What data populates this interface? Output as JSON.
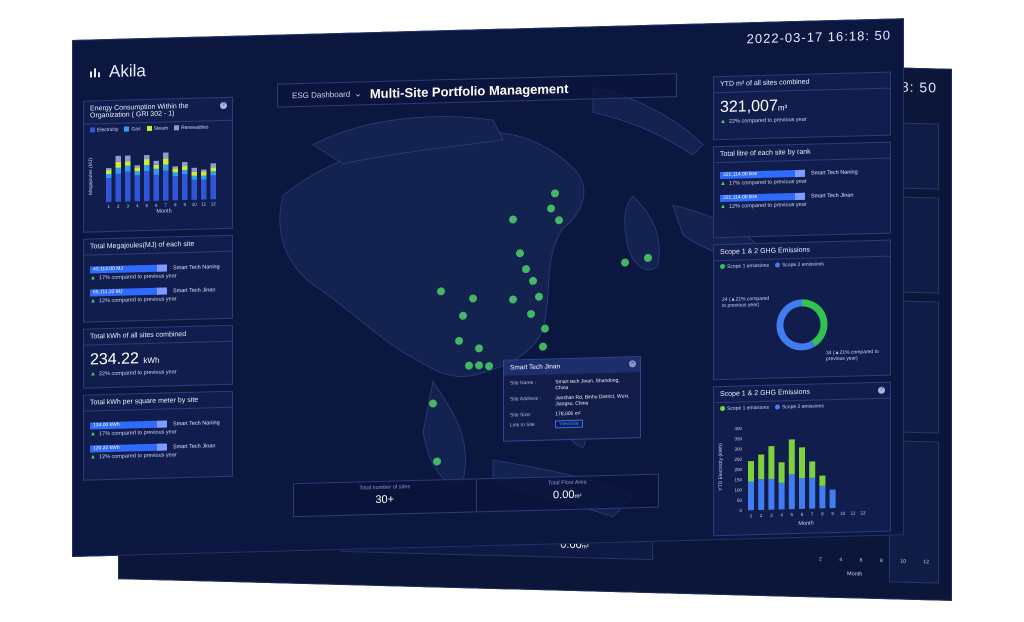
{
  "back_screen": {
    "clock": "16:18: 50",
    "total_sites": "30+",
    "total_area": "0.00",
    "area_unit": "m²",
    "month_label": "Month",
    "tick_values": [
      "2",
      "4",
      "6",
      "8",
      "10",
      "12"
    ]
  },
  "header": {
    "brand": "Akila",
    "datetime": "2022-03-17  16:18: 50",
    "dropdown_label": "ESG Dashboard",
    "title": "Multi-Site Portfolio Management"
  },
  "energy_panel": {
    "title": "Energy Consumption Within the Organization ( GRI 302 - 1)",
    "legend": [
      "Electricity",
      "Gas",
      "Steam",
      "Renewables"
    ],
    "ylabel": "Megajoules (MJ)",
    "xlabel": "Month",
    "chart_data": {
      "type": "bar",
      "categories": [
        "1",
        "2",
        "3",
        "4",
        "5",
        "6",
        "7",
        "8",
        "9",
        "10",
        "11",
        "12"
      ],
      "series": [
        {
          "name": "Electricity",
          "values": [
            12,
            14,
            15,
            13,
            15,
            13,
            15,
            12,
            13,
            10,
            10,
            12
          ]
        },
        {
          "name": "Gas",
          "values": [
            2,
            3,
            3,
            2,
            3,
            3,
            3,
            2,
            2,
            2,
            2,
            2
          ]
        },
        {
          "name": "Steam",
          "values": [
            2,
            3,
            2,
            2,
            3,
            2,
            3,
            2,
            2,
            2,
            2,
            2
          ]
        },
        {
          "name": "Renewables",
          "values": [
            1,
            3,
            3,
            1,
            2,
            2,
            3,
            1,
            2,
            2,
            1,
            2
          ]
        }
      ]
    },
    "colors": {
      "Electricity": "#2f55d8",
      "Gas": "#2f9ef0",
      "Steam": "#d0e838",
      "Renewables": "#8f9ccb"
    }
  },
  "mj_panel": {
    "title": "Total Megajoules(MJ) of each site",
    "rows": [
      {
        "value": "43,114.00 MJ",
        "site": "Smart Tech Naning",
        "compare": "17% compared to previous year"
      },
      {
        "value": "65,111.22 MJ",
        "site": "Smart Tech Jinan",
        "compare": "12% compared to previous year"
      }
    ]
  },
  "kwh_panel": {
    "title": "Total kWh of all sites combined",
    "value": "234.22",
    "unit": "kWh",
    "compare": "22% compared to previous year"
  },
  "kwh_sqm_panel": {
    "title": "Total kWh per square meter by site",
    "rows": [
      {
        "value": "134.00 kWh",
        "site": "Smart Tech Naning",
        "compare": "17% compared to previous year"
      },
      {
        "value": "120.22 kWh",
        "site": "Smart Tech Jinan",
        "compare": "12% compared to previous year"
      }
    ]
  },
  "ytd_panel": {
    "title": "YTD m³ of all sites combined",
    "value": "321,007",
    "unit": "m³",
    "compare": "22% compared to previous year"
  },
  "litre_panel": {
    "title": "Total litre of each site by rank",
    "rows": [
      {
        "value": "321,114.00 litre",
        "site": "Smart Tech Naning",
        "compare": "17% compared to previous year"
      },
      {
        "value": "321,114.00 litre",
        "site": "Smart Tech Jinan",
        "compare": "12% compared to previous year"
      }
    ]
  },
  "ghg_donut": {
    "title": "Scope 1 & 2 GHG Emissions",
    "legend": [
      "Scope 1 emissions",
      "Scope 2 emissions"
    ],
    "label_left_value": "24",
    "label_left_text": "(▲21% compared to previous year)",
    "label_right_value": "34",
    "label_right_text": "(▲21% compared to previous year)",
    "chart_data": {
      "type": "pie",
      "categories": [
        "Scope 1 emissions",
        "Scope 2 emissions"
      ],
      "values": [
        24,
        34
      ]
    },
    "colors": {
      "scope1": "#31c24f",
      "scope2": "#3f7df0"
    }
  },
  "ghg_bars": {
    "title": "Scope 1 & 2 GHG Emissions",
    "legend": [
      "Scope 1 emissions",
      "Scope 2 emissions"
    ],
    "ylabel": "YTD Electricity (kWh)",
    "xlabel": "Month",
    "yticks": [
      "0",
      "50",
      "100",
      "150",
      "200",
      "250",
      "300",
      "350",
      "400"
    ],
    "chart_data": {
      "type": "bar",
      "categories": [
        "1",
        "2",
        "3",
        "4",
        "5",
        "6",
        "7",
        "8",
        "9",
        "10",
        "11",
        "12"
      ],
      "ylim": [
        0,
        400
      ],
      "series": [
        {
          "name": "Scope 2 emissions",
          "values": [
            140,
            150,
            150,
            130,
            170,
            150,
            150,
            110,
            90,
            0,
            0,
            0
          ]
        },
        {
          "name": "Scope 1 emissions",
          "values": [
            100,
            120,
            160,
            100,
            170,
            150,
            80,
            50,
            0,
            0,
            0,
            0
          ]
        }
      ]
    }
  },
  "popup": {
    "title": "Smart Tech Jinan",
    "site_name_label": "Site Name :",
    "site_name": "Smart tech Jinan, Shandong, China",
    "site_address_label": "Site Address :",
    "site_address": "Junshan Rd, Binhu District, Wuxi, Jiangsu, China",
    "site_size_label": "Site Size:",
    "site_size": "178,000 m²",
    "link_label": "Link to Site",
    "link_button": "ViewSite"
  },
  "stats": {
    "sites_label": "Total number of sites",
    "sites_value": "30+",
    "area_label": "Total Floor Area",
    "area_value": "0.00",
    "area_unit": "m²"
  }
}
